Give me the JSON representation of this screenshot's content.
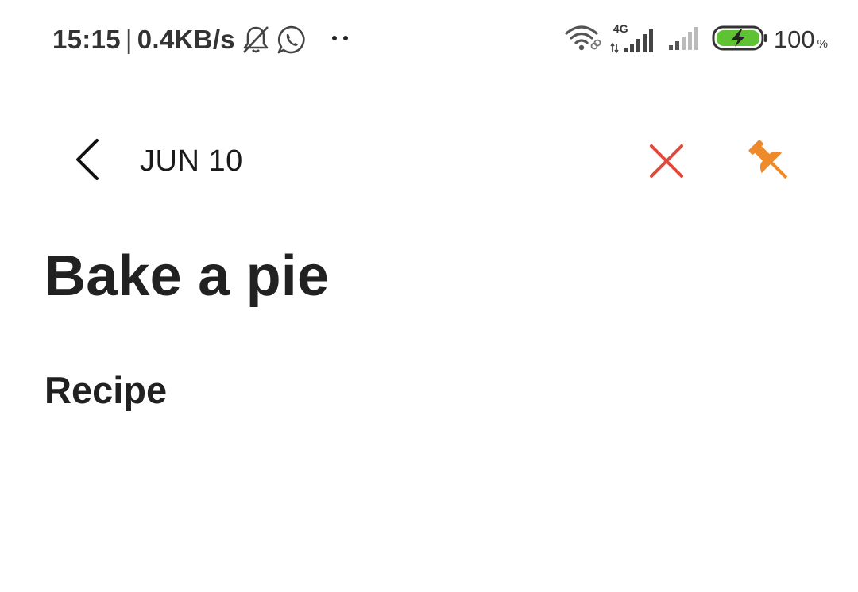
{
  "status_bar": {
    "time": "15:15",
    "separator": "|",
    "net_speed": "0.4KB/s",
    "network_type": "4G",
    "battery_level": "100",
    "battery_unit": "%",
    "icons": [
      "bell-off-icon",
      "whatsapp-icon",
      "wifi-icon",
      "signal-icon",
      "battery-charging-icon"
    ],
    "battery_color": "#5ec232"
  },
  "app_bar": {
    "back_icon": "chevron-left-icon",
    "date": "JUN 10",
    "close_icon": "close-icon",
    "close_color": "#e0493b",
    "pin_icon": "pin-icon",
    "pin_color": "#ef8a2a"
  },
  "note": {
    "title": "Bake a pie",
    "body": "Recipe"
  }
}
